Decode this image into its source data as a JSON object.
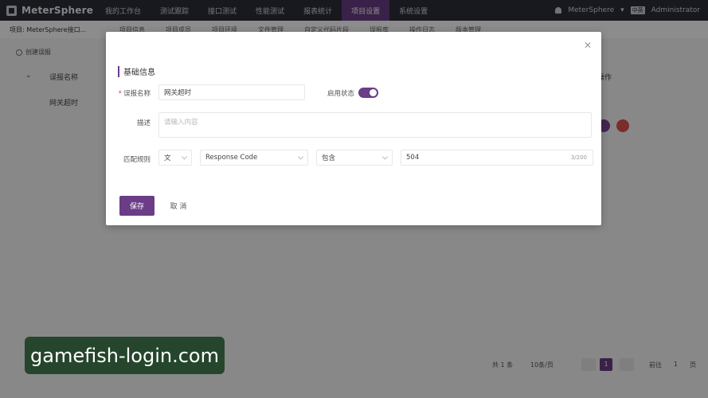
{
  "app": {
    "logo_text": "MeterSphere"
  },
  "topnav": {
    "items": [
      {
        "label": "我的工作台"
      },
      {
        "label": "测试跟踪"
      },
      {
        "label": "接口测试"
      },
      {
        "label": "性能测试"
      },
      {
        "label": "报表统计"
      },
      {
        "label": "项目设置"
      },
      {
        "label": "系统设置"
      }
    ],
    "active_index": 5,
    "workspace": "MeterSphere",
    "lang_badge": "中英",
    "user": "Administrator"
  },
  "subnav": {
    "project": "项目: MeterSphere接口...",
    "tabs": [
      "项目信息",
      "项目成员",
      "项目环境",
      "文件管理",
      "自定义代码片段",
      "误报库",
      "操作日志",
      "版本管理"
    ]
  },
  "page": {
    "create_label": "创建误报",
    "columns": [
      "误报名称",
      "操作"
    ],
    "row_name": "网关超时",
    "pager": {
      "total": "共 1 条",
      "per_page": "10条/页",
      "current": "1",
      "goto_label": "前往",
      "goto_value": "1",
      "page_suffix": "页"
    }
  },
  "dialog": {
    "section_title": "基础信息",
    "name_label": "误报名称",
    "name_value": "网关超时",
    "enable_label": "启用状态",
    "enabled": true,
    "desc_label": "描述",
    "desc_placeholder": "请输入内容",
    "rule_label": "匹配规则",
    "rule_type": "文",
    "rule_field": "Response Code",
    "rule_op": "包含",
    "rule_value": "504",
    "rule_counter": "3/200",
    "save_label": "保存",
    "cancel_label": "取 消"
  },
  "watermark": "gamefish-login.com",
  "colors": {
    "accent": "#6a3d86",
    "topbar": "#2d2d3a",
    "watermark_bg": "#25462c"
  }
}
